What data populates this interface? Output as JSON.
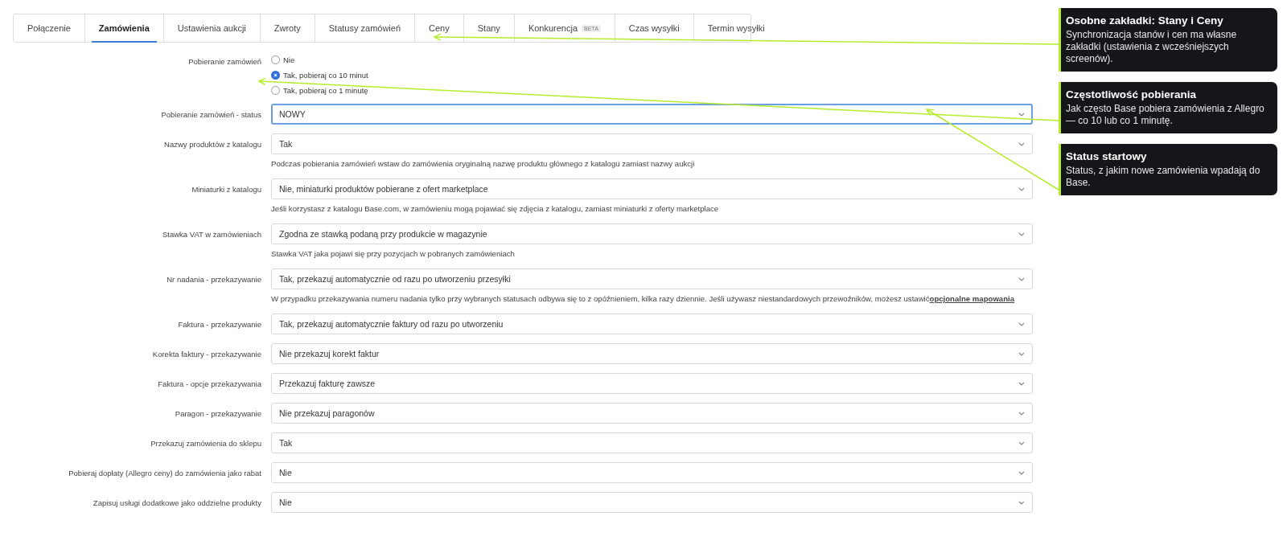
{
  "tabs": [
    {
      "label": "Połączenie",
      "selected": false
    },
    {
      "label": "Zamówienia",
      "selected": true
    },
    {
      "label": "Ustawienia aukcji",
      "selected": false
    },
    {
      "label": "Zwroty",
      "selected": false
    },
    {
      "label": "Statusy zamówień",
      "selected": false
    },
    {
      "label": "Ceny",
      "selected": false
    },
    {
      "label": "Stany",
      "selected": false
    },
    {
      "label": "Konkurencja",
      "badge": "BETA",
      "selected": false
    },
    {
      "label": "Czas wysyłki",
      "selected": false
    },
    {
      "label": "Termin wysyłki",
      "selected": false
    }
  ],
  "form": {
    "rows": [
      {
        "kind": "radio",
        "label": "Pobieranie zamówień",
        "options": [
          {
            "label": "Nie",
            "selected": false
          },
          {
            "label": "Tak, pobieraj co 10 minut",
            "selected": true
          },
          {
            "label": "Tak, pobieraj co 1 minutę",
            "selected": false
          }
        ]
      },
      {
        "kind": "select",
        "label": "Pobieranie zamówień - status",
        "value": "NOWY",
        "focused": true
      },
      {
        "kind": "select",
        "label": "Nazwy produktów z katalogu",
        "value": "Tak",
        "focused": false,
        "help": "Podczas pobierania zamówień wstaw do zamówienia oryginalną nazwę produktu głównego z katalogu zamiast nazwy aukcji"
      },
      {
        "kind": "select",
        "label": "Miniaturki z katalogu",
        "value": "Nie, miniaturki produktów pobierane z ofert marketplace",
        "focused": false,
        "help": "Jeśli korzystasz z katalogu Base.com, w zamówieniu mogą pojawiać się zdjęcia z katalogu, zamiast miniaturki z oferty marketplace"
      },
      {
        "kind": "select",
        "label": "Stawka VAT w zamówieniach",
        "value": "Zgodna ze stawką podaną przy produkcie w magazynie",
        "focused": false,
        "help": "Stawka VAT jaka pojawi się przy pozycjach w pobranych zamówieniach"
      },
      {
        "kind": "select",
        "label": "Nr nadania - przekazywanie",
        "value": "Tak, przekazuj automatycznie od razu po utworzeniu przesyłki",
        "focused": false,
        "help": "W przypadku przekazywania numeru nadania tylko przy wybranych statusach odbywa się to z opóźnieniem, kilka razy dziennie. Jeśli używasz niestandardowych przewoźników, możesz ustawić",
        "link": "opcjonalne mapowania"
      },
      {
        "kind": "select",
        "label": "Faktura - przekazywanie",
        "value": "Tak, przekazuj automatycznie faktury od razu po utworzeniu",
        "focused": false
      },
      {
        "kind": "select",
        "label": "Korekta faktury - przekazywanie",
        "value": "Nie przekazuj korekt faktur",
        "focused": false
      },
      {
        "kind": "select",
        "label": "Faktura - opcje przekazywania",
        "value": "Przekazuj fakturę zawsze",
        "focused": false
      },
      {
        "kind": "select",
        "label": "Paragon - przekazywanie",
        "value": "Nie przekazuj paragonów",
        "focused": false
      },
      {
        "kind": "select",
        "label": "Przekazuj zamówienia do sklepu",
        "value": "Tak",
        "focused": false
      },
      {
        "kind": "select",
        "label": "Pobieraj dopłaty (Allegro ceny) do zamówienia jako rabat",
        "value": "Nie",
        "focused": false
      },
      {
        "kind": "select",
        "label": "Zapisuj usługi dodatkowe jako oddzielne produkty",
        "value": "Nie",
        "focused": false
      }
    ]
  },
  "callouts": [
    {
      "title": "Osobne zakładki: Stany i Ceny",
      "text": "Synchronizacja stanów i cen ma własne zakładki (ustawienia z wcześniejszych screenów)."
    },
    {
      "title": "Częstotliwość pobierania",
      "text": "Jak często Base pobiera zamówienia z Allegro — co 10 lub co 1 minutę."
    },
    {
      "title": "Status startowy",
      "text": "Status, z jakim nowe zamówienia wpadają do Base."
    }
  ]
}
